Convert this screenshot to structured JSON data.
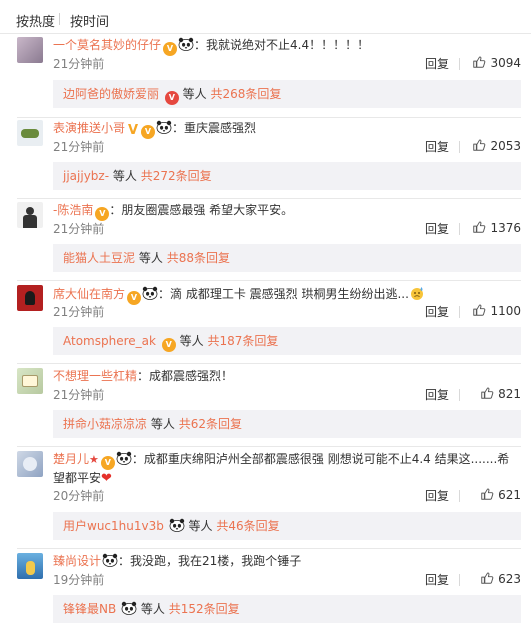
{
  "sort": {
    "hot": "按热度",
    "time": "按时间"
  },
  "reply_label": "回复",
  "comments": [
    {
      "user": "一个莫名其妙的仔仔",
      "text": "：我就说绝对不止4.4！！！！！",
      "time": "21分钟前",
      "likes": "3094",
      "sub_user": "边阿爸的傲娇爱丽",
      "sub_mid": "等人",
      "sub_count": "共268条回复"
    },
    {
      "user": "表演推送小哥",
      "text": "：重庆震感强烈",
      "time": "21分钟前",
      "likes": "2053",
      "sub_user": "jjajjybz-",
      "sub_mid": "等人",
      "sub_count": "共272条回复"
    },
    {
      "user": "-陈浩南",
      "text": "：朋友圈震感最强 希望大家平安。",
      "time": "21分钟前",
      "likes": "1376",
      "sub_user": "能猫人土豆泥",
      "sub_mid": "等人",
      "sub_count": "共88条回复"
    },
    {
      "user": "席大仙在南方",
      "text": "：滴 成都理工卡 震感强烈 珙桐男生纷纷出逃...",
      "time": "21分钟前",
      "likes": "1100",
      "sub_user": "Atomsphere_ak",
      "sub_mid": "等人",
      "sub_count": "共187条回复"
    },
    {
      "user": "不想理一些杠精",
      "text": "：成都震感强烈！",
      "time": "21分钟前",
      "likes": "821",
      "sub_user": "拼命小菇凉凉凉",
      "sub_mid": "等人",
      "sub_count": "共62条回复"
    },
    {
      "user": "楚月儿",
      "text": "：成都重庆绵阳泸州全部都震感很强 刚想说可能不止4.4 结果这.......希望都平安",
      "time": "20分钟前",
      "likes": "621",
      "sub_user": "用户wuc1hu1v3b",
      "sub_mid": "等人",
      "sub_count": "共46条回复"
    },
    {
      "user": "臻尚设计",
      "text": "：我没跑，我在21楼，我跑个锤子",
      "time": "19分钟前",
      "likes": "623",
      "sub_user": "锋锋最NB",
      "sub_mid": "等人",
      "sub_count": "共152条回复"
    }
  ]
}
